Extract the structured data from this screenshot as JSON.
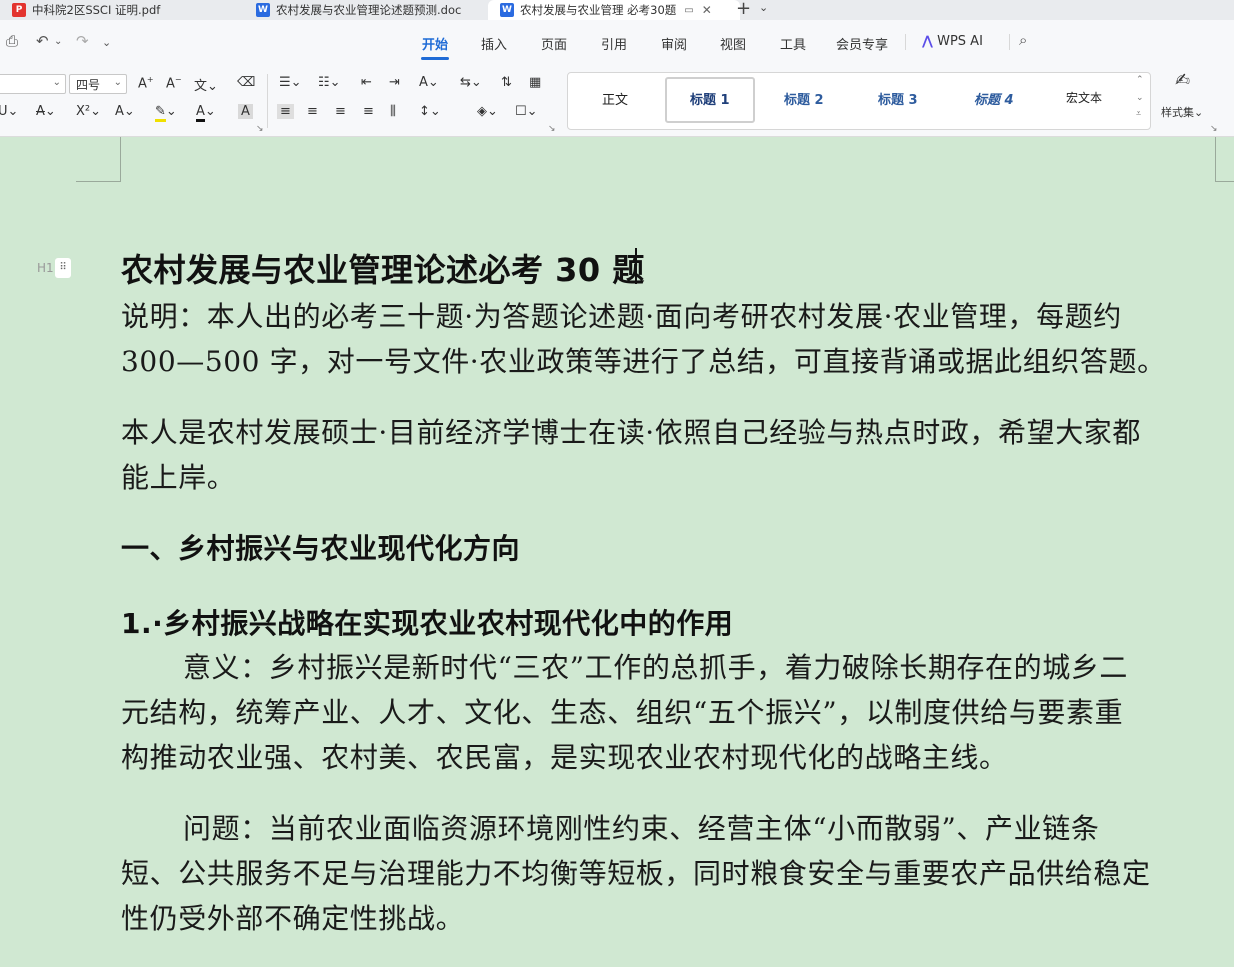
{
  "tabs": [
    {
      "label": "中科院2区SSCI 证明.pdf",
      "icon": "pdf-icon"
    },
    {
      "label": "农村发展与农业管理论述题预测.doc",
      "icon": "word-doc-icon"
    },
    {
      "label": "农村发展与农业管理 必考30题",
      "icon": "word-doc-icon"
    }
  ],
  "menu": {
    "items": [
      "开始",
      "插入",
      "页面",
      "引用",
      "审阅",
      "视图",
      "工具",
      "会员专享"
    ],
    "active": "开始",
    "wps_ai": "WPS AI"
  },
  "ribbon": {
    "font_size": "四号",
    "styles": [
      "正文",
      "标题 1",
      "标题 2",
      "标题 3",
      "标题 4",
      "宏文本"
    ],
    "styles_selected": "标题 1",
    "style_set": "样式集"
  },
  "document": {
    "title": "农村发展与农业管理论述必考 30 题",
    "heading_marker": "H1",
    "intro_line1": "说明：本人出的必考三十题·为答题论述题·面向考研农村发展·农业管理，每题约",
    "intro_line2": "300—500 字，对一号文件·农业政策等进行了总结，可直接背诵或据此组织答题。",
    "author_line1": "本人是农村发展硕士·目前经济学博士在读·依照自己经验与热点时政，希望大家都",
    "author_line2": "能上岸。",
    "section_heading": "一、乡村振兴与农业现代化方向",
    "q1_heading": "1.·乡村振兴战略在实现农业农村现代化中的作用",
    "meaning_lines": [
      "意义：乡村振兴是新时代“三农”工作的总抓手，着力破除长期存在的城乡二",
      "元结构，统筹产业、人才、文化、生态、组织“五个振兴”，以制度供给与要素重",
      "构推动农业强、农村美、农民富，是实现农业农村现代化的战略主线。"
    ],
    "problem_lines": [
      "问题：当前农业面临资源环境刚性约束、经营主体“小而散弱”、产业链条",
      "短、公共服务不足与治理能力不均衡等短板，同时粮食安全与重要农产品供给稳定",
      "性仍受外部不确定性挑战。"
    ]
  }
}
